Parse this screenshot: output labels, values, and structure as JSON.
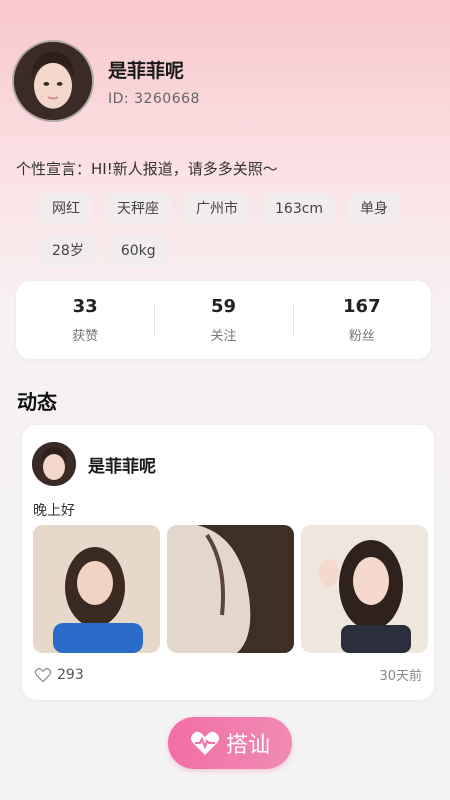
{
  "profile": {
    "name": "是菲菲呢",
    "id_text": "ID: 3260668",
    "motto": "个性宣言：HI!新人报道，请多多关照～",
    "tags": [
      "网红",
      "天秤座",
      "广州市",
      "163cm",
      "单身",
      "28岁",
      "60kg"
    ]
  },
  "stats": [
    {
      "value": "33",
      "label": "获赞"
    },
    {
      "value": "59",
      "label": "关注"
    },
    {
      "value": "167",
      "label": "粉丝"
    }
  ],
  "feed": {
    "section_title": "动态",
    "post": {
      "author": "是菲菲呢",
      "text": "晚上好",
      "likes": "293",
      "time": "30天前",
      "photo_count": 3
    }
  },
  "actions": {
    "chat_label": "搭讪",
    "icons": {
      "heart_pulse": "heart-pulse-icon",
      "like": "heart-outline-icon"
    }
  },
  "colors": {
    "accent": "#f26ea4",
    "header_bg": "#f8c7cc"
  }
}
